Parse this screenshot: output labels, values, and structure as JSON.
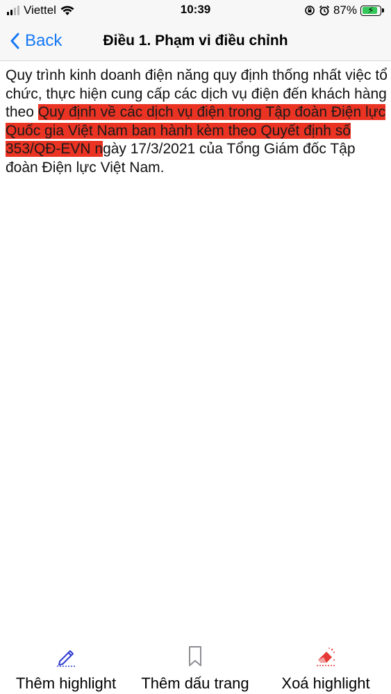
{
  "status_bar": {
    "carrier": "Viettel",
    "time": "10:39",
    "battery_percent": "87%",
    "battery_level": 0.87
  },
  "nav": {
    "back_label": "Back",
    "title": "Điều 1. Phạm vi điều chỉnh"
  },
  "content": {
    "text_before": "Quy trình kinh doanh điện năng quy định thống nhất việc tổ chức, thực hiện cung cấp các dịch vụ điện đến khách hàng theo ",
    "text_highlighted": "Quy định về các dịch vụ điện trong Tập đoàn Điện lực Quốc gia Việt Nam ban hành kèm theo Quyết định số 353/QĐ-EVN n",
    "text_after": "gày 17/3/2021 của Tổng Giám đốc Tập đoàn Điện lực Việt Nam.",
    "highlight_color": "#ea3323"
  },
  "toolbar": {
    "add_highlight_label": "Thêm highlight",
    "add_bookmark_label": "Thêm dấu trang",
    "remove_highlight_label": "Xoá highlight"
  },
  "colors": {
    "accent": "#1478f5",
    "pencil": "#2f3bd1",
    "eraser": "#e53935"
  }
}
